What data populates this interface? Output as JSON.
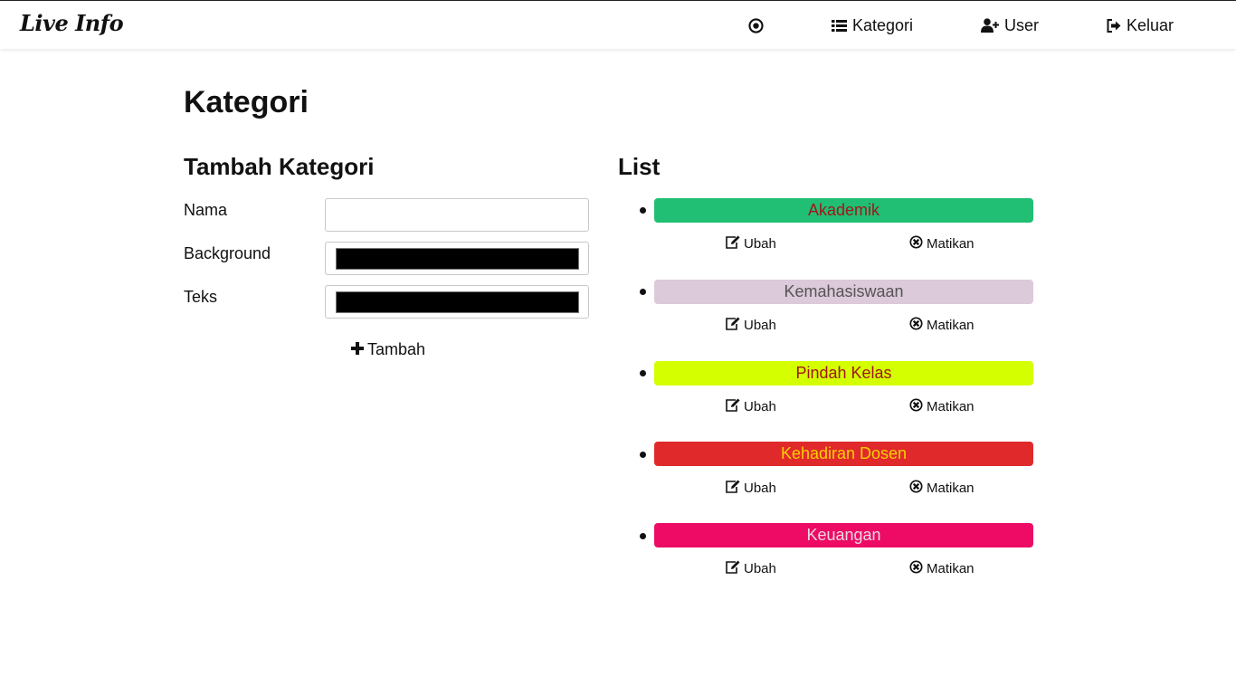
{
  "brand": "Live Info",
  "nav": {
    "kategori": "Kategori",
    "user": "User",
    "keluar": "Keluar"
  },
  "page_title": "Kategori",
  "form": {
    "title": "Tambah Kategori",
    "nama_label": "Nama",
    "nama_value": "",
    "background_label": "Background",
    "background_value": "#000000",
    "teks_label": "Teks",
    "teks_value": "#000000",
    "submit_label": "Tambah"
  },
  "list": {
    "title": "List",
    "edit_label": "Ubah",
    "disable_label": "Matikan",
    "items": [
      {
        "name": "Akademik",
        "background": "#21bf73",
        "text_color": "#a0161b"
      },
      {
        "name": "Kemahasiswaan",
        "background": "#dcc9da",
        "text_color": "#555555"
      },
      {
        "name": "Pindah Kelas",
        "background": "#d4ff00",
        "text_color": "#a0161b"
      },
      {
        "name": "Kehadiran Dosen",
        "background": "#e0292b",
        "text_color": "#f6d000"
      },
      {
        "name": "Keuangan",
        "background": "#ed0b65",
        "text_color": "#e8d8e0"
      }
    ]
  }
}
